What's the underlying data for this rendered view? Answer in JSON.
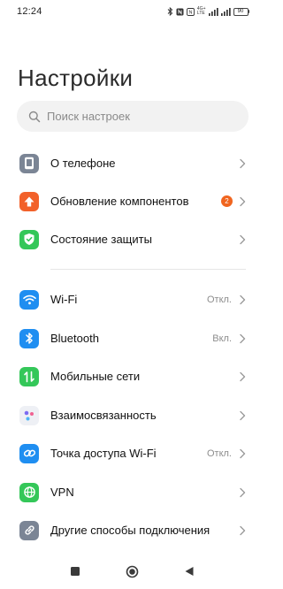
{
  "status_bar": {
    "time": "12:24",
    "network_label_top": "4G+",
    "network_label_bottom": "LTE",
    "battery": "90"
  },
  "page": {
    "title": "Настройки"
  },
  "search": {
    "placeholder": "Поиск настроек"
  },
  "groups": {
    "top": [
      {
        "label": "О телефоне",
        "icon": "phone-icon",
        "color": "#7b8595"
      },
      {
        "label": "Обновление компонентов",
        "icon": "update-arrow-icon",
        "color": "#f2612a",
        "badge": "2"
      },
      {
        "label": "Состояние защиты",
        "icon": "shield-check-icon",
        "color": "#34c759"
      }
    ],
    "connections": [
      {
        "label": "Wi-Fi",
        "icon": "wifi-icon",
        "color": "#1f8ef1",
        "value": "Откл."
      },
      {
        "label": "Bluetooth",
        "icon": "bluetooth-icon",
        "color": "#1f8ef1",
        "value": "Вкл."
      },
      {
        "label": "Мобильные сети",
        "icon": "mobile-data-icon",
        "color": "#34c759"
      },
      {
        "label": "Взаимосвязанность",
        "icon": "interconnect-dots-icon",
        "color": "#eef0f5"
      },
      {
        "label": "Точка доступа Wi-Fi",
        "icon": "hotspot-link-icon",
        "color": "#1f8ef1",
        "value": "Откл."
      },
      {
        "label": "VPN",
        "icon": "globe-icon",
        "color": "#34c759"
      },
      {
        "label": "Другие способы подключения",
        "icon": "link-icon",
        "color": "#7b8595"
      }
    ]
  },
  "nav_bar": {
    "buttons": [
      "recents-square-icon",
      "home-circle-icon",
      "back-triangle-icon"
    ]
  }
}
